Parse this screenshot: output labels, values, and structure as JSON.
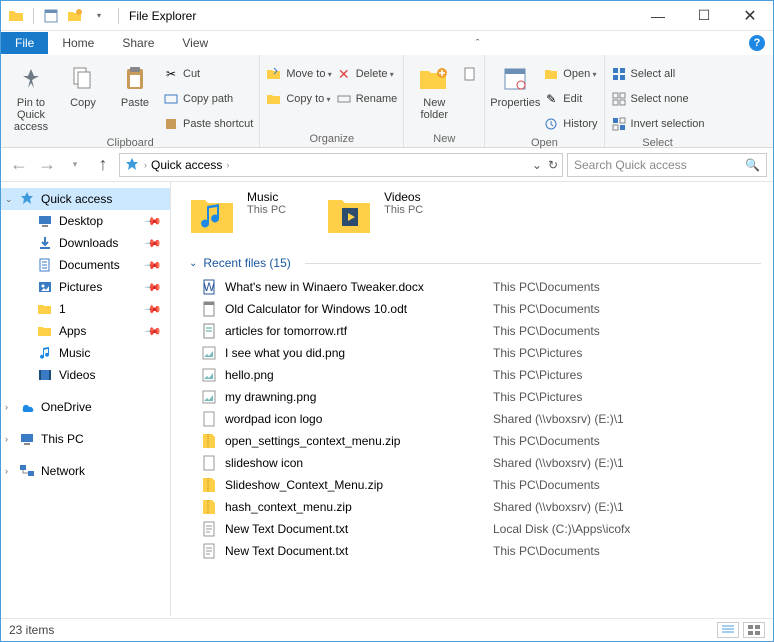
{
  "window": {
    "title": "File Explorer"
  },
  "tabs": {
    "file": "File",
    "home": "Home",
    "share": "Share",
    "view": "View"
  },
  "ribbon": {
    "clipboard": {
      "label": "Clipboard",
      "pin": "Pin to Quick access",
      "copy": "Copy",
      "paste": "Paste",
      "cut": "Cut",
      "copypath": "Copy path",
      "pasteshortcut": "Paste shortcut"
    },
    "organize": {
      "label": "Organize",
      "moveto": "Move to",
      "copyto": "Copy to",
      "delete": "Delete",
      "rename": "Rename"
    },
    "new": {
      "label": "New",
      "newfolder": "New folder"
    },
    "open": {
      "label": "Open",
      "properties": "Properties",
      "open": "Open",
      "edit": "Edit",
      "history": "History"
    },
    "select": {
      "label": "Select",
      "all": "Select all",
      "none": "Select none",
      "invert": "Invert selection"
    }
  },
  "breadcrumb": {
    "root": "Quick access"
  },
  "search": {
    "placeholder": "Search Quick access"
  },
  "tree": {
    "quick": "Quick access",
    "items": [
      {
        "label": "Desktop"
      },
      {
        "label": "Downloads"
      },
      {
        "label": "Documents"
      },
      {
        "label": "Pictures"
      },
      {
        "label": "1"
      },
      {
        "label": "Apps"
      },
      {
        "label": "Music",
        "nopin": true
      },
      {
        "label": "Videos",
        "nopin": true
      }
    ],
    "onedrive": "OneDrive",
    "thispc": "This PC",
    "network": "Network"
  },
  "tiles": [
    {
      "name": "Music",
      "loc": "This PC"
    },
    {
      "name": "Videos",
      "loc": "This PC"
    }
  ],
  "section": {
    "title": "Recent files (15)"
  },
  "files": [
    {
      "name": "What's new in Winaero Tweaker.docx",
      "path": "This PC\\Documents"
    },
    {
      "name": "Old Calculator for Windows 10.odt",
      "path": "This PC\\Documents"
    },
    {
      "name": "articles for tomorrow.rtf",
      "path": "This PC\\Documents"
    },
    {
      "name": "I see what you did.png",
      "path": "This PC\\Pictures"
    },
    {
      "name": "hello.png",
      "path": "This PC\\Pictures"
    },
    {
      "name": "my drawning.png",
      "path": "This PC\\Pictures"
    },
    {
      "name": "wordpad icon logo",
      "path": "Shared (\\\\vboxsrv) (E:)\\1"
    },
    {
      "name": "open_settings_context_menu.zip",
      "path": "This PC\\Documents"
    },
    {
      "name": "slideshow icon",
      "path": "Shared (\\\\vboxsrv) (E:)\\1"
    },
    {
      "name": "Slideshow_Context_Menu.zip",
      "path": "This PC\\Documents"
    },
    {
      "name": "hash_context_menu.zip",
      "path": "Shared (\\\\vboxsrv) (E:)\\1"
    },
    {
      "name": "New Text Document.txt",
      "path": "Local Disk (C:)\\Apps\\icofx"
    },
    {
      "name": "New Text Document.txt",
      "path": "This PC\\Documents"
    }
  ],
  "status": {
    "items": "23 items"
  }
}
